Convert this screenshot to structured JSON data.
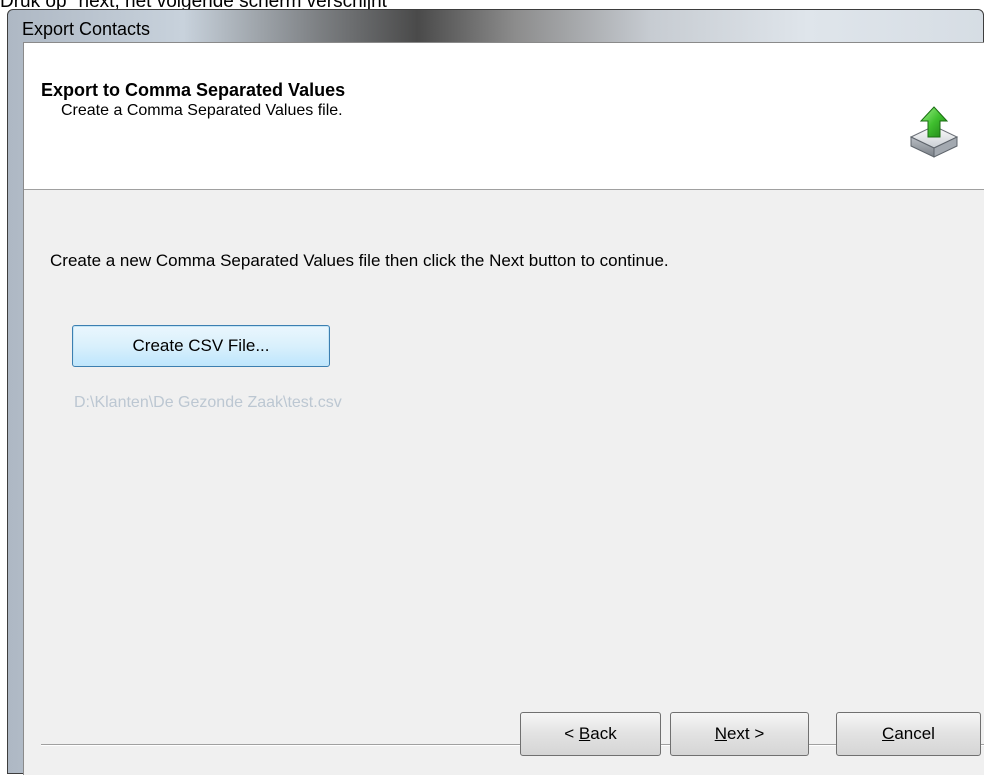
{
  "page_caption": "Druk op \"next, het volgende scherm verschijnt",
  "window": {
    "title": "Export Contacts"
  },
  "header": {
    "title": "Export to Comma Separated Values",
    "subtitle": "Create a Comma Separated Values file.",
    "icon": "export-upload-icon"
  },
  "body": {
    "instruction": "Create a new Comma Separated Values file then click the Next button to continue.",
    "create_button_label": "Create CSV File...",
    "file_path": "D:\\Klanten\\De Gezonde Zaak\\test.csv"
  },
  "footer": {
    "back_prefix": "< ",
    "back_mnemonic": "B",
    "back_rest": "ack",
    "next_mnemonic": "N",
    "next_rest": "ext >",
    "cancel_mnemonic": "C",
    "cancel_rest": "ancel"
  },
  "colors": {
    "accent_border": "#3c7fb1",
    "disabled_text": "#bcc7d2",
    "dialog_bg": "#f0f0f0"
  }
}
